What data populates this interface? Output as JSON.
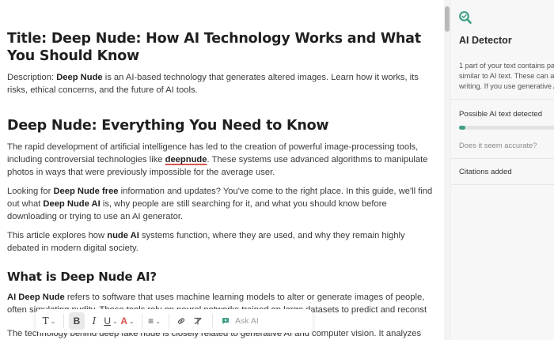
{
  "document": {
    "title": "Title: Deep Nude: How AI Technology Works and What You Should Know",
    "description": {
      "prefix": "Description: ",
      "bold": "Deep Nude",
      "rest": " is an AI-based technology that generates altered images. Learn how it works, its risks, ethical concerns, and the future of AI tools."
    },
    "heading1": "Deep Nude: Everything You Need to Know",
    "para1": {
      "before": "The rapid development of artificial intelligence has led to the creation of powerful image-processing tools, including controversial technologies like ",
      "keyword": "deepnude",
      "after": ". These systems use advanced algorithms to manipulate photos in ways that were previously impossible for the average user."
    },
    "para2": {
      "a": "Looking for ",
      "b1": "Deep Nude free",
      "c": " information and updates? You've come to the right place. In this guide, we'll find out what ",
      "b2": "Deep Nude AI",
      "d": " is, why people are still searching for it, and what you should know before downloading or trying to use an AI generator."
    },
    "para3": {
      "a": "This article explores how ",
      "b": "nude AI",
      "c": " systems function, where they are used, and why they remain highly debated in modern digital society."
    },
    "heading2": "What is Deep Nude AI?",
    "para4": {
      "b": "AI Deep Nude",
      "rest": " refers to software that uses machine learning models to alter or generate images of people, often simulating nudity. These tools rely on neural networks trained on large datasets to predict and reconst"
    },
    "para5_cut": "The technology behind deep fake nude is closely related to generative AI and computer vision. It analyzes"
  },
  "toolbar": {
    "text_style": "T",
    "bold": "B",
    "italic": "I",
    "underline": "U",
    "font_color": "A",
    "align": "≡",
    "link": "🔗",
    "clear_format": "T̸",
    "ask_ai": "Ask AI"
  },
  "panel": {
    "title": "AI Detector",
    "description": "1 part of your text contains patterns that are similar to AI text. These can also occur in human writing. If you use generative AI, you can cite it.",
    "possible_label": "Possible AI text detected",
    "possible_fraction": 0.06,
    "accurate_prompt": "Does it seem accurate?",
    "citations_label": "Citations added",
    "accent": "#3e9e86"
  }
}
